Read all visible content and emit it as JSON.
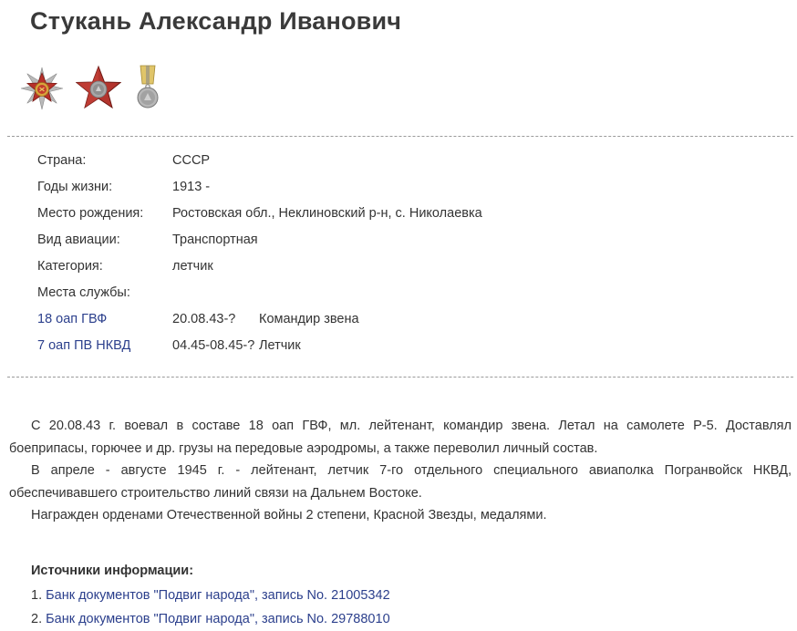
{
  "title": "Стукань Александр Иванович",
  "awards": [
    {
      "icon": "order-patriotic-war-icon"
    },
    {
      "icon": "order-red-star-icon"
    },
    {
      "icon": "medal-icon"
    }
  ],
  "info": {
    "country": {
      "label": "Страна:",
      "value": "СССР"
    },
    "years": {
      "label": "Годы жизни:",
      "value": "1913 -"
    },
    "birthplace": {
      "label": "Место рождения:",
      "value": "Ростовская обл., Неклиновский р-н, с. Николаевка"
    },
    "aviation": {
      "label": "Вид авиации:",
      "value": "Транспортная"
    },
    "category": {
      "label": "Категория:",
      "value": "летчик"
    },
    "service_label": "Места службы:",
    "service": [
      {
        "unit": "18 оап ГВФ",
        "dates": "20.08.43-?",
        "position": "Командир звена"
      },
      {
        "unit": "7 оап ПВ НКВД",
        "dates": "04.45-08.45-?",
        "position": "Летчик"
      }
    ]
  },
  "biography": [
    "С 20.08.43 г. воевал в составе 18 оап ГВФ, мл. лейтенант, командир звена. Летал на самолете Р-5. Доставлял боеприпасы, горючее и др. грузы на передовые аэродромы, а также переволил личный состав.",
    "В апреле - августе 1945 г. - лейтенант, летчик 7-го отдельного специального авиаполка Погранвойск НКВД, обеспечивавшего строительство линий связи на Дальнем Востоке.",
    "Награжден орденами Отечественной войны 2 степени, Красной Звезды, медалями."
  ],
  "sources": {
    "heading": "Источники информации:",
    "items": [
      {
        "num": "1.",
        "text": "Банк документов \"Подвиг народа\", запись No. 21005342"
      },
      {
        "num": "2.",
        "text": "Банк документов \"Подвиг народа\", запись No. 29788010"
      }
    ]
  },
  "colors": {
    "link": "#2b3f8c",
    "text": "#333333",
    "title": "#3a3a3a",
    "divider": "#9a9a9a"
  }
}
